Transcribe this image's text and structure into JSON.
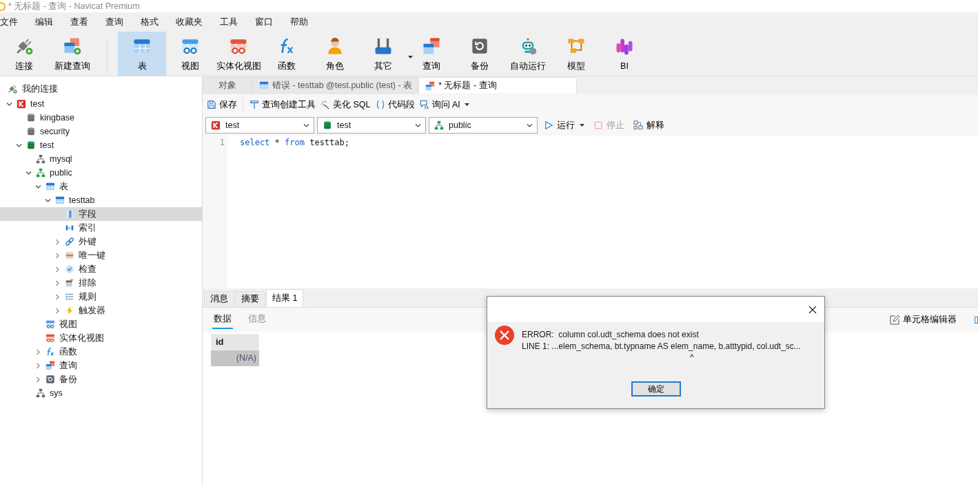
{
  "window": {
    "title": "* 无标题 - 查询 - Navicat Premium"
  },
  "menu": [
    "文件",
    "编辑",
    "查看",
    "查询",
    "格式",
    "收藏夹",
    "工具",
    "窗口",
    "帮助"
  ],
  "toolbar": {
    "groups": [
      [
        {
          "label": "连接",
          "kind": "connect",
          "selected": false
        },
        {
          "label": "新建查询",
          "kind": "new-query",
          "selected": false
        }
      ],
      [
        {
          "label": "表",
          "kind": "table",
          "selected": true
        },
        {
          "label": "视图",
          "kind": "view",
          "selected": false
        },
        {
          "label": "实体化视图",
          "kind": "mview",
          "selected": false
        },
        {
          "label": "函数",
          "kind": "function",
          "selected": false
        },
        {
          "label": "角色",
          "kind": "role",
          "selected": false
        },
        {
          "label": "其它",
          "kind": "tools",
          "selected": false,
          "dropdown": true
        },
        {
          "label": "查询",
          "kind": "query",
          "selected": false
        },
        {
          "label": "备份",
          "kind": "backup",
          "selected": false
        },
        {
          "label": "自动运行",
          "kind": "robot",
          "selected": false
        },
        {
          "label": "模型",
          "kind": "model",
          "selected": false
        },
        {
          "label": "BI",
          "kind": "bi",
          "selected": false
        }
      ]
    ]
  },
  "sidebar": {
    "header": "我的连接",
    "tree": [
      {
        "label": "test",
        "kind": "k-connection",
        "expanded": true,
        "selected": false,
        "children": [
          {
            "label": "kingbase",
            "kind": "db-grey",
            "selected": false
          },
          {
            "label": "security",
            "kind": "db-grey",
            "selected": false
          },
          {
            "label": "test",
            "kind": "db-green",
            "expanded": true,
            "selected": false,
            "children": [
              {
                "label": "mysql",
                "kind": "schema-grey",
                "selected": false
              },
              {
                "label": "public",
                "kind": "schema-green",
                "expanded": true,
                "selected": false,
                "children": [
                  {
                    "label": "表",
                    "kind": "table",
                    "expanded": true,
                    "selected": false,
                    "children": [
                      {
                        "label": "testtab",
                        "kind": "table",
                        "expanded": true,
                        "selected": false,
                        "children": [
                          {
                            "label": "字段",
                            "kind": "fields",
                            "selected": true
                          },
                          {
                            "label": "索引",
                            "kind": "index",
                            "selected": false
                          },
                          {
                            "label": "外键",
                            "kind": "link",
                            "expanded": false,
                            "selected": false
                          },
                          {
                            "label": "唯一键",
                            "kind": "unique",
                            "expanded": false,
                            "selected": false
                          },
                          {
                            "label": "检查",
                            "kind": "check",
                            "expanded": false,
                            "selected": false
                          },
                          {
                            "label": "排除",
                            "kind": "exclude",
                            "expanded": false,
                            "selected": false
                          },
                          {
                            "label": "规则",
                            "kind": "rules",
                            "expanded": false,
                            "selected": false
                          },
                          {
                            "label": "触发器",
                            "kind": "trigger",
                            "expanded": false,
                            "selected": false
                          }
                        ]
                      }
                    ]
                  },
                  {
                    "label": "视图",
                    "kind": "view",
                    "selected": false
                  },
                  {
                    "label": "实体化视图",
                    "kind": "mview",
                    "selected": false
                  },
                  {
                    "label": "函数",
                    "kind": "function",
                    "expanded": false,
                    "selected": false
                  },
                  {
                    "label": "查询",
                    "kind": "query",
                    "expanded": false,
                    "selected": false
                  },
                  {
                    "label": "备份",
                    "kind": "backup",
                    "expanded": false,
                    "selected": false
                  }
                ]
              },
              {
                "label": "sys",
                "kind": "schema-grey",
                "selected": false
              }
            ]
          }
        ]
      }
    ]
  },
  "tabs": [
    {
      "label": "对象",
      "kind": "none",
      "selected": false
    },
    {
      "label": "错误 - testtab @test.public (test) - 表",
      "kind": "table",
      "selected": false
    },
    {
      "label": "* 无标题 - 查询",
      "kind": "query",
      "selected": true
    }
  ],
  "query_toolbar": [
    {
      "label": "保存",
      "kind": "save"
    },
    {
      "label": "查询创建工具",
      "kind": "builder"
    },
    {
      "label": "美化 SQL",
      "kind": "beautify"
    },
    {
      "label": "代码段",
      "kind": "snippet"
    },
    {
      "label": "询问 AI",
      "kind": "ai",
      "dropdown": true
    }
  ],
  "selectors": [
    {
      "value": "test",
      "kind": "k-connection"
    },
    {
      "value": "test",
      "kind": "db-green"
    },
    {
      "value": "public",
      "kind": "schema-green"
    }
  ],
  "run_controls": [
    {
      "label": "运行",
      "kind": "run",
      "disabled": false,
      "dropdown": true
    },
    {
      "label": "停止",
      "kind": "stop",
      "disabled": true
    },
    {
      "label": "解释",
      "kind": "explain",
      "disabled": false
    }
  ],
  "editor": {
    "lines": [
      {
        "number": "1",
        "tokens": [
          {
            "text": "select",
            "kind": "keyword"
          },
          {
            "text": " * ",
            "kind": "plain"
          },
          {
            "text": "from",
            "kind": "keyword"
          },
          {
            "text": " testtab;",
            "kind": "plain"
          }
        ]
      }
    ]
  },
  "result_tabs": [
    {
      "label": "消息",
      "selected": false
    },
    {
      "label": "摘要",
      "selected": false
    },
    {
      "label": "结果 1",
      "selected": true
    }
  ],
  "result_subtabs": [
    {
      "label": "数据",
      "selected": true
    },
    {
      "label": "信息",
      "selected": false
    }
  ],
  "cell_editor": {
    "label": "单元格编辑器"
  },
  "grid": {
    "columns": [
      "id"
    ],
    "rows": [
      {
        "cells": [
          "(N/A)"
        ],
        "selected": true
      }
    ]
  },
  "dialog": {
    "lines": [
      "ERROR:  column col.udt_schema does not exist",
      "LINE 1: ...elem_schema, bt.typname AS elem_name, b.atttypid, col.udt_sc..."
    ],
    "pointer": "^",
    "button": "确定"
  }
}
